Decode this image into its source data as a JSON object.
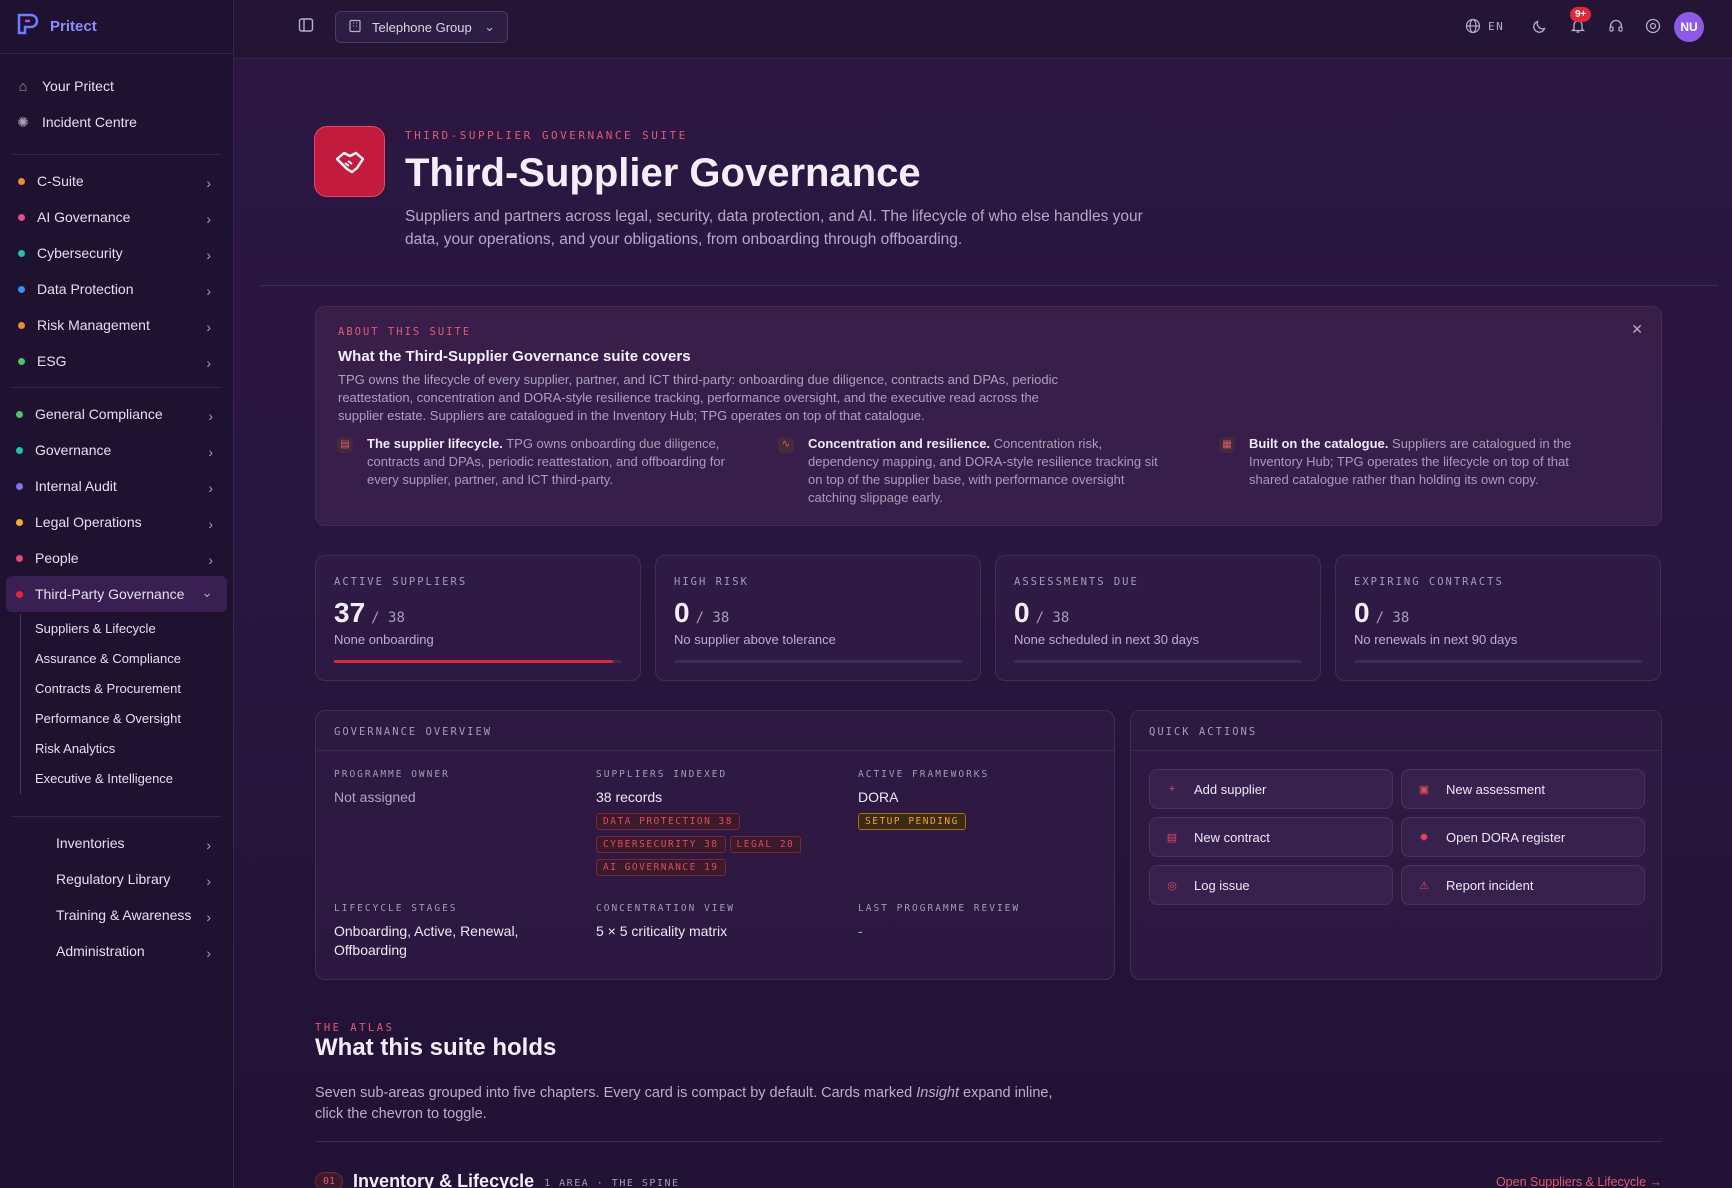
{
  "app": {
    "name": "Pritect"
  },
  "sidebar": {
    "top": [
      {
        "label": "Your Pritect"
      },
      {
        "label": "Incident Centre"
      }
    ],
    "group1": [
      {
        "label": "C-Suite",
        "color": "#f08a2c"
      },
      {
        "label": "AI Governance",
        "color": "#e74a8c"
      },
      {
        "label": "Cybersecurity",
        "color": "#22c3a8"
      },
      {
        "label": "Data Protection",
        "color": "#3d8cf0"
      },
      {
        "label": "Risk Management",
        "color": "#f08a2c"
      },
      {
        "label": "ESG",
        "color": "#4cc26a"
      }
    ],
    "group2": [
      {
        "label": "General Compliance",
        "color": "#4cc26a"
      },
      {
        "label": "Governance",
        "color": "#22c3a8"
      },
      {
        "label": "Internal Audit",
        "color": "#7c74f0"
      },
      {
        "label": "Legal Operations",
        "color": "#f0b02c"
      },
      {
        "label": "People",
        "color": "#e74a6c"
      },
      {
        "label": "Third-Party Governance",
        "color": "#e0273b"
      }
    ],
    "sub": [
      "Suppliers & Lifecycle",
      "Assurance & Compliance",
      "Contracts & Procurement",
      "Performance & Oversight",
      "Risk Analytics",
      "Executive & Intelligence"
    ],
    "group3": [
      {
        "label": "Inventories"
      },
      {
        "label": "Regulatory Library"
      },
      {
        "label": "Training & Awareness"
      },
      {
        "label": "Administration"
      }
    ]
  },
  "topbar": {
    "group": "Telephone Group",
    "lang": "EN",
    "badge": "9+",
    "avatar": "NU"
  },
  "hero": {
    "eyebrow": "THIRD-SUPPLIER GOVERNANCE SUITE",
    "title": "Third-Supplier Governance",
    "desc": "Suppliers and partners across legal, security, data protection, and AI. The lifecycle of who else handles your data, your operations, and your obligations, from onboarding through offboarding."
  },
  "about": {
    "label": "ABOUT THIS SUITE",
    "title": "What the Third-Supplier Governance suite covers",
    "desc": "TPG owns the lifecycle of every supplier, partner, and ICT third-party: onboarding due diligence, contracts and DPAs, periodic reattestation, concentration and DORA-style resilience tracking, performance oversight, and the executive read across the supplier estate. Suppliers are catalogued in the Inventory Hub; TPG operates on top of that catalogue.",
    "cols": [
      {
        "title": "The supplier lifecycle.",
        "text": "TPG owns onboarding due diligence, contracts and DPAs, periodic reattestation, and offboarding for every supplier, partner, and ICT third-party."
      },
      {
        "title": "Concentration and resilience.",
        "text": "Concentration risk, dependency mapping, and DORA-style resilience tracking sit on top of the supplier base, with performance oversight catching slippage early."
      },
      {
        "title": "Built on the catalogue.",
        "text": "Suppliers are catalogued in the Inventory Hub; TPG operates the lifecycle on top of that shared catalogue rather than holding its own copy."
      }
    ]
  },
  "stats": [
    {
      "label": "ACTIVE SUPPLIERS",
      "value": "37",
      "total": "/ 38",
      "sub": "None onboarding",
      "progress": 0.97
    },
    {
      "label": "HIGH RISK",
      "value": "0",
      "total": "/ 38",
      "sub": "No supplier above tolerance",
      "progress": 0
    },
    {
      "label": "ASSESSMENTS DUE",
      "value": "0",
      "total": "/ 38",
      "sub": "None scheduled in next 30 days",
      "progress": 0
    },
    {
      "label": "EXPIRING CONTRACTS",
      "value": "0",
      "total": "/ 38",
      "sub": "No renewals in next 90 days",
      "progress": 0
    }
  ],
  "overview": {
    "label": "GOVERNANCE OVERVIEW",
    "owner_label": "PROGRAMME OWNER",
    "owner": "Not assigned",
    "indexed_label": "SUPPLIERS INDEXED",
    "indexed": "38 records",
    "indexed_tags": [
      "DATA PROTECTION 38",
      "CYBERSECURITY 38",
      "LEGAL 20",
      "AI GOVERNANCE 19"
    ],
    "frameworks_label": "ACTIVE FRAMEWORKS",
    "frameworks": "DORA",
    "frameworks_tag": "SETUP PENDING",
    "stages_label": "LIFECYCLE STAGES",
    "stages": "Onboarding, Active, Renewal, Offboarding",
    "conc_label": "CONCENTRATION VIEW",
    "conc": "5 × 5 criticality matrix",
    "review_label": "LAST PROGRAMME REVIEW",
    "review": "-"
  },
  "quick": {
    "label": "QUICK ACTIONS",
    "actions": [
      {
        "label": "Add supplier",
        "icon": "plus-icon"
      },
      {
        "label": "New assessment",
        "icon": "clipboard-icon"
      },
      {
        "label": "New contract",
        "icon": "document-icon"
      },
      {
        "label": "Open DORA register",
        "icon": "gear-icon"
      },
      {
        "label": "Log issue",
        "icon": "alert-circle-icon"
      },
      {
        "label": "Report incident",
        "icon": "warning-icon"
      }
    ]
  },
  "atlas": {
    "eyebrow": "THE ATLAS",
    "title": "What this suite holds",
    "desc_a": "Seven sub-areas grouped into five chapters. Every card is compact by default. Cards marked ",
    "desc_em": "Insight",
    "desc_b": " expand inline, click the chevron to toggle.",
    "chapter_num": "01",
    "chapter_title": "Inventory & Lifecycle",
    "chapter_meta": "1 AREA · THE SPINE",
    "chapter_link": "Open Suppliers & Lifecycle →"
  }
}
